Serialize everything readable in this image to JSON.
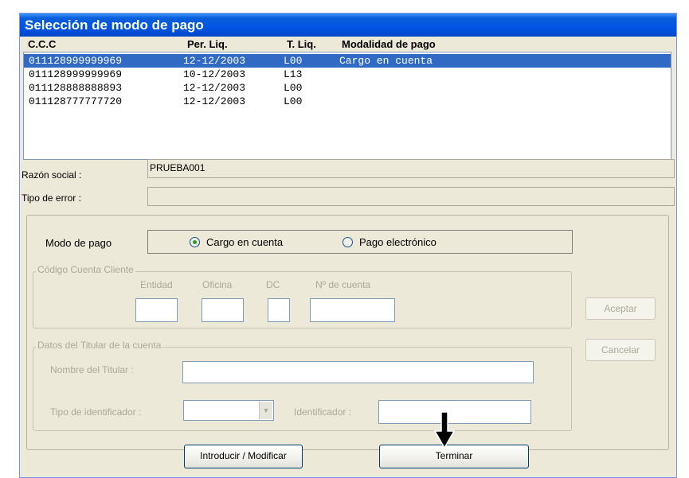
{
  "window": {
    "title": "Selección de modo de pago"
  },
  "list": {
    "headers": [
      "C.C.C",
      "Per. Liq.",
      "T. Liq.",
      "Modalidad de pago"
    ],
    "rows": [
      {
        "ccc": "011128999999969",
        "per": "12-12/2003",
        "tliq": "L00",
        "modalidad": "Cargo en cuenta",
        "selected": true
      },
      {
        "ccc": "011128999999969",
        "per": "10-12/2003",
        "tliq": "L13",
        "modalidad": "",
        "selected": false
      },
      {
        "ccc": "011128888888893",
        "per": "12-12/2003",
        "tliq": "L00",
        "modalidad": "",
        "selected": false
      },
      {
        "ccc": "011128777777720",
        "per": "12-12/2003",
        "tliq": "L00",
        "modalidad": "",
        "selected": false
      }
    ]
  },
  "info": {
    "razon_label": "Razón social :",
    "razon_value": "PRUEBA001",
    "error_label": "Tipo de error :",
    "error_value": ""
  },
  "modo": {
    "label": "Modo de pago",
    "option1": "Cargo en cuenta",
    "option2": "Pago electrónico",
    "selected": "Cargo en cuenta"
  },
  "ccc_group": {
    "legend": "Código Cuenta Cliente",
    "entidad": "Entidad",
    "oficina": "Oficina",
    "dc": "DC",
    "cuenta": "Nº de cuenta"
  },
  "titular_group": {
    "legend": "Datos del Titular de la cuenta",
    "nombre": "Nombre del Titular :",
    "tipo_id": "Tipo de identificador :",
    "identificador": "Identificador :"
  },
  "buttons": {
    "aceptar": "Aceptar",
    "cancelar": "Cancelar",
    "introducir": "Introducir / Modificar",
    "terminar": "Terminar"
  },
  "colors": {
    "title": "#0054e3",
    "selection": "#316ac5",
    "disabled_text": "#aca899"
  },
  "icons": {
    "cursor": "arrow-down-cursor-icon",
    "combo": "chevron-down-icon"
  }
}
